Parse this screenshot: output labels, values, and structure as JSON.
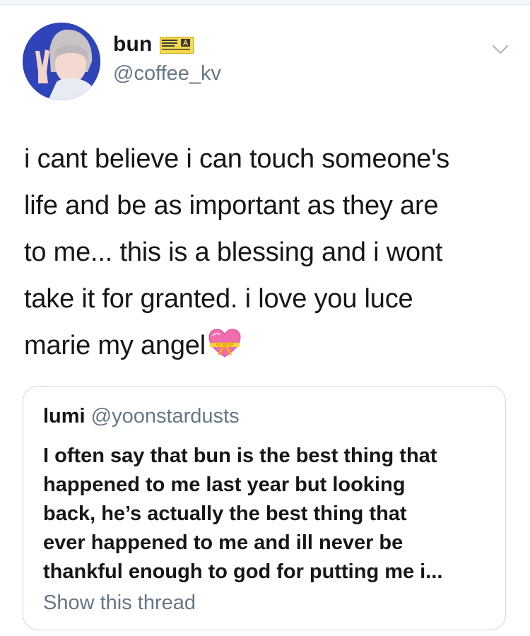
{
  "tweet": {
    "display_name": "bun",
    "handle": "@coffee_kv",
    "text_lines": [
      "i cant believe i can touch someone's",
      "life and be as important as they are",
      "to me... this is a blessing and i wont",
      "take it for granted. i love you luce",
      "marie my angel"
    ],
    "emoji": "heart-with-ribbon-icon"
  },
  "quote": {
    "display_name": "lumi",
    "handle": "@yoonstardusts",
    "text_lines": [
      "I often say that bun is the best thing that",
      "happened to me last year but looking",
      "back, he’s actually the best thing that",
      "ever happened to me and ill never be",
      "thankful enough to god for putting me i..."
    ],
    "show_thread_label": "Show this thread"
  },
  "colors": {
    "text_primary": "#14171a",
    "text_secondary": "#657786",
    "border": "#ccd6dd",
    "avatar_bg": "#2b3fb5"
  }
}
